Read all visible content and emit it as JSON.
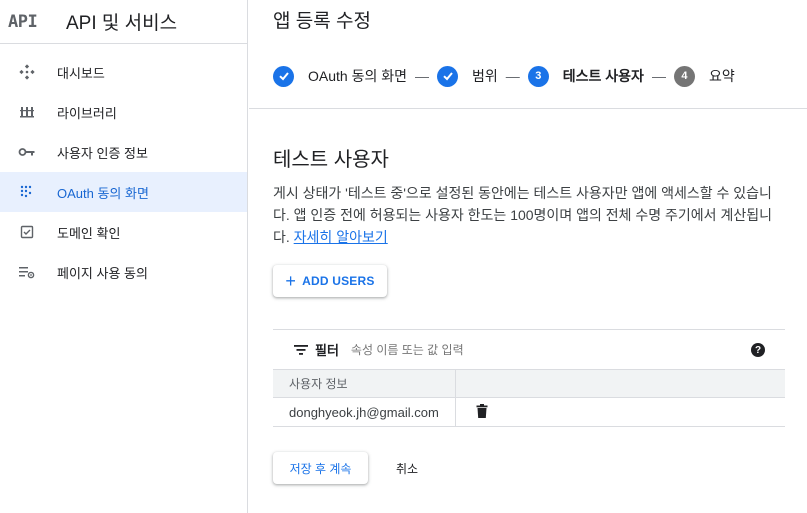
{
  "sidebar": {
    "logo": "API",
    "title": "API 및 서비스",
    "items": [
      {
        "label": "대시보드",
        "icon": "dashboard-icon"
      },
      {
        "label": "라이브러리",
        "icon": "library-icon"
      },
      {
        "label": "사용자 인증 정보",
        "icon": "key-icon"
      },
      {
        "label": "OAuth 동의 화면",
        "icon": "oauth-consent-icon",
        "active": true
      },
      {
        "label": "도메인 확인",
        "icon": "checkbox-icon"
      },
      {
        "label": "페이지 사용 동의",
        "icon": "settings-list-icon"
      }
    ]
  },
  "page": {
    "title": "앱 등록 수정"
  },
  "stepper": {
    "separator": "—",
    "steps": [
      {
        "number": "",
        "label": "OAuth 동의 화면",
        "state": "done"
      },
      {
        "number": "",
        "label": "범위",
        "state": "done"
      },
      {
        "number": "3",
        "label": "테스트 사용자",
        "state": "current"
      },
      {
        "number": "4",
        "label": "요약",
        "state": "todo"
      }
    ]
  },
  "section": {
    "title": "테스트 사용자",
    "description": "게시 상태가 '테스트 중'으로 설정된 동안에는 테스트 사용자만 앱에 액세스할 수 있습니다. 앱 인증 전에 허용되는 사용자 한도는 100명이며 앱의 전체 수명 주기에서 계산됩니다. ",
    "learn_more": "자세히 알아보기"
  },
  "add_users_label": "ADD USERS",
  "table": {
    "filter_label": "필터",
    "filter_placeholder": "속성 이름 또는 값 입력",
    "columns": [
      "사용자 정보",
      ""
    ],
    "rows": [
      {
        "email": "donghyeok.jh@gmail.com"
      }
    ]
  },
  "actions": {
    "save_label": "저장 후 계속",
    "cancel_label": "취소"
  },
  "colors": {
    "accent": "#1a73e8",
    "active_bg": "#e8f0fe",
    "step_todo": "#757575"
  }
}
